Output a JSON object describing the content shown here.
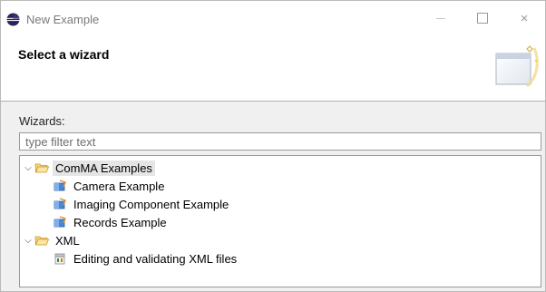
{
  "window": {
    "title": "New Example",
    "app_icon": "eclipse-icon",
    "controls": {
      "minimize": "minimize-icon",
      "maximize": "maximize-icon",
      "close_glyph": "×"
    }
  },
  "header": {
    "title": "Select a wizard",
    "banner_icon": "new-wizard-banner-icon"
  },
  "wizards": {
    "label": "Wizards:",
    "filter_placeholder": "type filter text",
    "filter_value": ""
  },
  "tree": [
    {
      "label": "ComMA Examples",
      "type": "folder",
      "expanded": true,
      "selected": true,
      "icon": "open-folder-icon",
      "children": [
        {
          "label": "Camera Example",
          "icon": "example-project-icon"
        },
        {
          "label": "Imaging Component Example",
          "icon": "example-project-icon"
        },
        {
          "label": "Records Example",
          "icon": "example-project-icon"
        }
      ]
    },
    {
      "label": "XML",
      "type": "folder",
      "expanded": true,
      "selected": false,
      "icon": "open-folder-icon",
      "children": [
        {
          "label": "Editing and validating XML files",
          "icon": "xml-example-icon"
        }
      ]
    }
  ],
  "colors": {
    "selection": "#e5e5e5",
    "folder": "#e8b84a",
    "example_blue": "#3a78c8",
    "example_orange": "#e08a2c"
  }
}
